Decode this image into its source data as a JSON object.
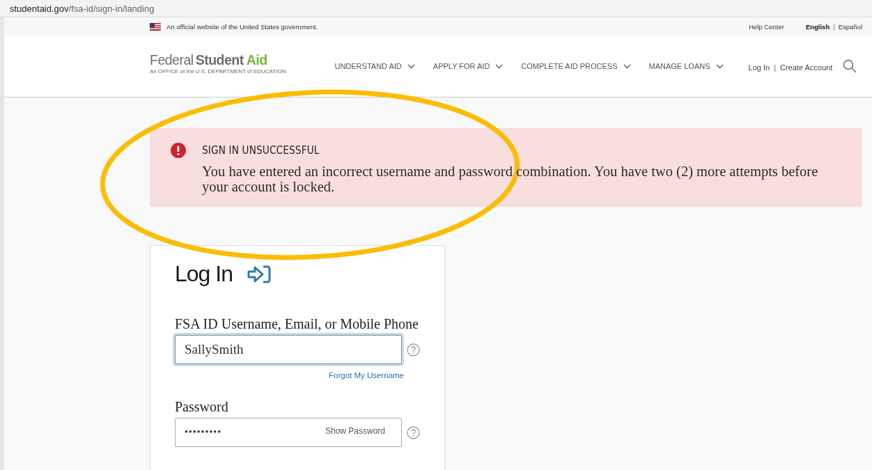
{
  "browser": {
    "url_host": "studentaid.gov",
    "url_path": "/fsa-id/sign-in/landing"
  },
  "gov_banner": {
    "text": "An official website of the United States government.",
    "help": "Help Center",
    "language_separator": "|",
    "languages": [
      {
        "label": "English",
        "selected": true
      },
      {
        "label": "Español",
        "selected": false
      }
    ]
  },
  "header": {
    "logo_word_1": "Federal",
    "logo_word_2": "Student",
    "logo_word_3": "Aid",
    "logo_tagline": "An OFFICE of the U.S. DEPARTMENT of EDUCATION",
    "nav": [
      {
        "label": "UNDERSTAND AID"
      },
      {
        "label": "APPLY FOR AID"
      },
      {
        "label": "COMPLETE AID PROCESS"
      },
      {
        "label": "MANAGE LOANS"
      }
    ],
    "account_links": [
      "Log In",
      "Create Account"
    ],
    "account_separator": "|"
  },
  "alert": {
    "title": "SIGN IN UNSUCCESSFUL",
    "message": "You have entered an incorrect username and password combination. You have two (2) more attempts before your account is locked."
  },
  "login": {
    "title": "Log In",
    "fields": [
      {
        "kind": "text",
        "label": "FSA ID Username, Email, or Mobile Phone",
        "value": "SallySmith",
        "focused": true,
        "link": "Forgot My Username"
      },
      {
        "kind": "password",
        "label": "Password",
        "value": "•••••••••",
        "focused": false,
        "toggle": "Show Password"
      }
    ]
  }
}
